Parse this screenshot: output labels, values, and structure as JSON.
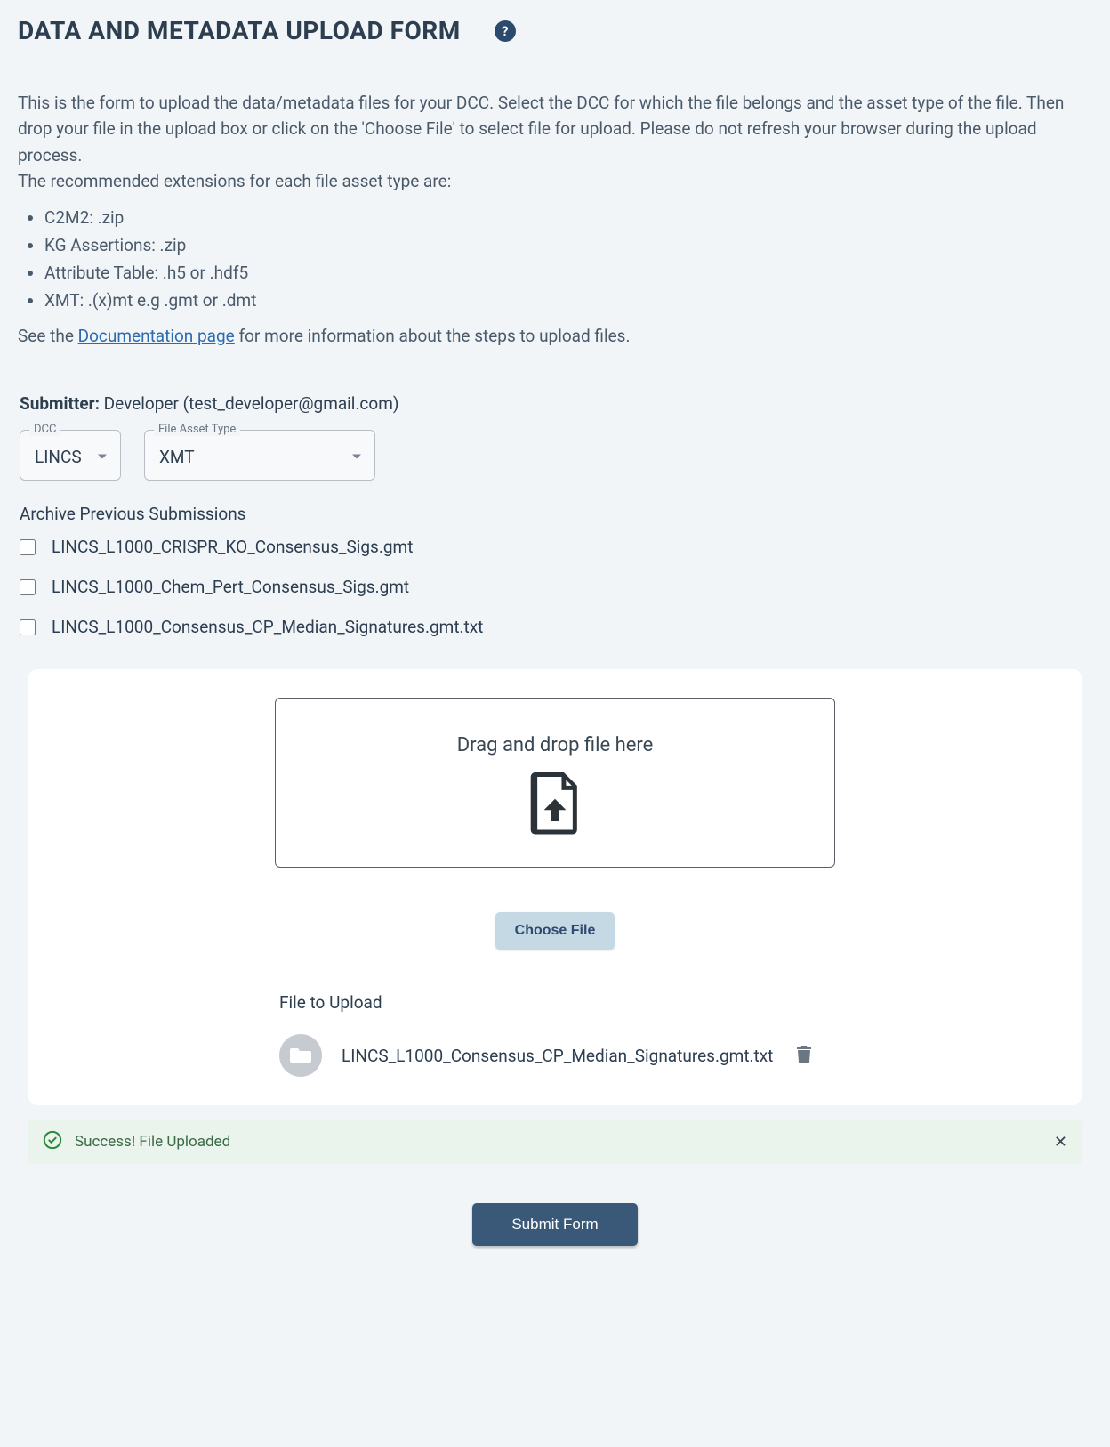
{
  "header": {
    "title": "DATA AND METADATA UPLOAD FORM",
    "help_icon": "help-icon"
  },
  "intro": {
    "p1": "This is the form to upload the data/metadata files for your DCC. Select the DCC for which the file belongs and the asset type of the file. Then drop your file in the upload box or click on the 'Choose File' to select file for upload. Please do not refresh your browser during the upload process.",
    "p2": "The recommended extensions for each file asset type are:",
    "file_types": [
      "C2M2: .zip",
      "KG Assertions: .zip",
      "Attribute Table: .h5 or .hdf5",
      "XMT: .(x)mt e.g .gmt or .dmt"
    ],
    "doc_prefix": "See the ",
    "doc_link_text": "Documentation page",
    "doc_suffix": " for more information about the steps to upload files."
  },
  "form": {
    "submitter_label": "Submitter:",
    "submitter_value": "Developer (test_developer@gmail.com)",
    "dcc": {
      "label": "DCC",
      "value": "LINCS"
    },
    "file_asset_type": {
      "label": "File Asset Type",
      "value": "XMT"
    },
    "archive": {
      "title": "Archive Previous Submissions",
      "items": [
        {
          "name": "LINCS_L1000_CRISPR_KO_Consensus_Sigs.gmt",
          "checked": false
        },
        {
          "name": "LINCS_L1000_Chem_Pert_Consensus_Sigs.gmt",
          "checked": false
        },
        {
          "name": "LINCS_L1000_Consensus_CP_Median_Signatures.gmt.txt",
          "checked": false
        }
      ]
    },
    "dropzone_text": "Drag and drop file here",
    "choose_file_label": "Choose File",
    "file_to_upload_label": "File to Upload",
    "selected_file": "LINCS_L1000_Consensus_CP_Median_Signatures.gmt.txt",
    "success_message": "Success! File Uploaded",
    "submit_label": "Submit Form"
  }
}
